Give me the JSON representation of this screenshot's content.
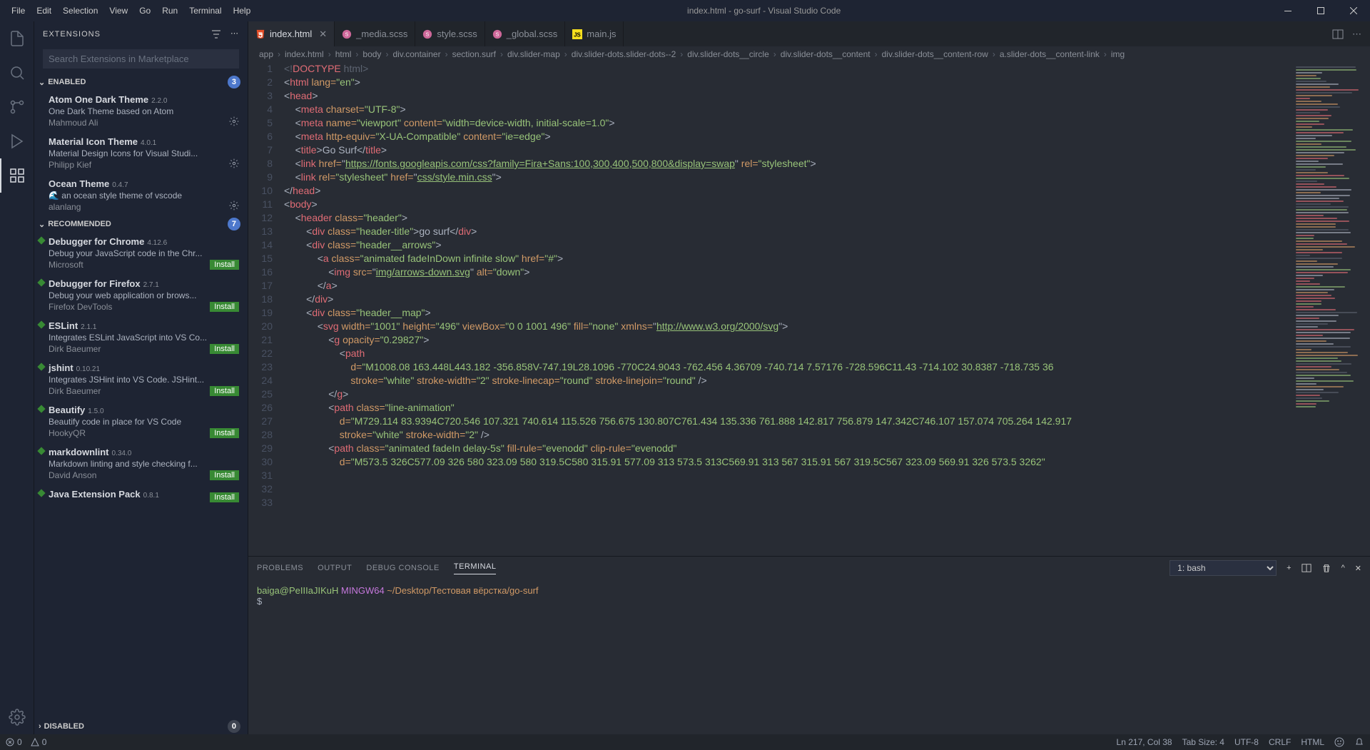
{
  "title": "index.html - go-surf - Visual Studio Code",
  "menu": [
    "File",
    "Edit",
    "Selection",
    "View",
    "Go",
    "Run",
    "Terminal",
    "Help"
  ],
  "sidebar": {
    "title": "EXTENSIONS",
    "search_placeholder": "Search Extensions in Marketplace",
    "enabled_label": "ENABLED",
    "enabled_count": "3",
    "recommended_label": "RECOMMENDED",
    "recommended_count": "7",
    "disabled_label": "DISABLED",
    "disabled_count": "0",
    "install_label": "Install"
  },
  "enabled_exts": [
    {
      "name": "Atom One Dark Theme",
      "ver": "2.2.0",
      "desc": "One Dark Theme based on Atom",
      "pub": "Mahmoud Ali"
    },
    {
      "name": "Material Icon Theme",
      "ver": "4.0.1",
      "desc": "Material Design Icons for Visual Studi...",
      "pub": "Philipp Kief"
    },
    {
      "name": "Ocean Theme",
      "ver": "0.4.7",
      "desc": "🌊 an ocean style theme of vscode",
      "pub": "alanlang"
    }
  ],
  "rec_exts": [
    {
      "name": "Debugger for Chrome",
      "ver": "4.12.6",
      "desc": "Debug your JavaScript code in the Chr...",
      "pub": "Microsoft"
    },
    {
      "name": "Debugger for Firefox",
      "ver": "2.7.1",
      "desc": "Debug your web application or brows...",
      "pub": "Firefox DevTools"
    },
    {
      "name": "ESLint",
      "ver": "2.1.1",
      "desc": "Integrates ESLint JavaScript into VS Co...",
      "pub": "Dirk Baeumer"
    },
    {
      "name": "jshint",
      "ver": "0.10.21",
      "desc": "Integrates JSHint into VS Code. JSHint...",
      "pub": "Dirk Baeumer"
    },
    {
      "name": "Beautify",
      "ver": "1.5.0",
      "desc": "Beautify code in place for VS Code",
      "pub": "HookyQR"
    },
    {
      "name": "markdownlint",
      "ver": "0.34.0",
      "desc": "Markdown linting and style checking f...",
      "pub": "David Anson"
    },
    {
      "name": "Java Extension Pack",
      "ver": "0.8.1",
      "desc": "",
      "pub": ""
    }
  ],
  "tabs": [
    {
      "label": "index.html",
      "icon": "html",
      "active": true,
      "dirty": false
    },
    {
      "label": "_media.scss",
      "icon": "scss",
      "active": false
    },
    {
      "label": "style.scss",
      "icon": "scss",
      "active": false
    },
    {
      "label": "_global.scss",
      "icon": "scss",
      "active": false
    },
    {
      "label": "main.js",
      "icon": "js",
      "active": false
    }
  ],
  "breadcrumb": [
    "app",
    "index.html",
    "html",
    "body",
    "div.container",
    "section.surf",
    "div.slider-map",
    "div.slider-dots.slider-dots--2",
    "div.slider-dots__circle",
    "div.slider-dots__content",
    "div.slider-dots__content-row",
    "a.slider-dots__content-link",
    "img"
  ],
  "line_numbers": [
    "1",
    "2",
    "3",
    "4",
    "5",
    "6",
    "7",
    "8",
    "9",
    "10",
    "11",
    "12",
    "13",
    "14",
    "15",
    "16",
    "17",
    "18",
    "19",
    "20",
    "21",
    "22",
    "23",
    "24",
    "25",
    "26",
    "27",
    "28",
    "29",
    "30",
    "31",
    "32",
    "33"
  ],
  "panel": {
    "tabs": [
      "PROBLEMS",
      "OUTPUT",
      "DEBUG CONSOLE",
      "TERMINAL"
    ],
    "active": "TERMINAL",
    "term_select": "1: bash",
    "term_user": "baiga@PeIIIaJIKuH",
    "term_host": "MINGW64",
    "term_path": "~/Desktop/Тестовая вёрстка/go-surf",
    "prompt": "$"
  },
  "status": {
    "errors": "0",
    "warnings": "0",
    "cursor": "Ln 217, Col 38",
    "tab_size": "Tab Size: 4",
    "encoding": "UTF-8",
    "eol": "CRLF",
    "lang": "HTML",
    "feedback": "😊"
  },
  "code": {
    "l1": "<!DOCTYPE html>",
    "l2a": "<html",
    "l2b": " lang=",
    "l2c": "\"en\"",
    "l2d": ">",
    "l4": "<head>",
    "l5a": "<meta",
    "l5b": " charset=",
    "l5c": "\"UTF-8\"",
    "l5d": ">",
    "l6a": "<meta",
    "l6b": " name=",
    "l6c": "\"viewport\"",
    "l6d": " content=",
    "l6e": "\"width=device-width, initial-scale=1.0\"",
    "l6f": ">",
    "l7a": "<meta",
    "l7b": " http-equiv=",
    "l7c": "\"X-UA-Compatible\"",
    "l7d": " content=",
    "l7e": "\"ie=edge\"",
    "l7f": ">",
    "l8a": "<title>",
    "l8b": "Go Surf",
    "l8c": "</title>",
    "l9a": "<link",
    "l9b": " href=",
    "l9c": "\"https://fonts.googleapis.com/css?family=Fira+Sans:100,300,400,500,800&display=swap\"",
    "l9d": " rel=",
    "l9e": "\"stylesheet\"",
    "l9f": ">",
    "l10a": "<link",
    "l10b": " rel=",
    "l10c": "\"stylesheet\"",
    "l10d": " href=",
    "l10e": "\"css/style.min.css\"",
    "l10f": ">",
    "l11": "</head>",
    "l13": "<body>",
    "l15a": "<header",
    "l15b": " class=",
    "l15c": "\"header\"",
    "l15d": ">",
    "l16a": "<div",
    "l16b": " class=",
    "l16c": "\"header-title\"",
    "l16d": ">",
    "l16e": "go surf",
    "l16f": "</div>",
    "l17a": "<div",
    "l17b": " class=",
    "l17c": "\"header__arrows\"",
    "l17d": ">",
    "l18a": "<a",
    "l18b": " class=",
    "l18c": "\"animated fadeInDown infinite slow\"",
    "l18d": " href=",
    "l18e": "\"#\"",
    "l18f": ">",
    "l19a": "<img",
    "l19b": " src=",
    "l19c": "\"img/arrows-down.svg\"",
    "l19d": " alt=",
    "l19e": "\"down\"",
    "l19f": ">",
    "l20": "</a>",
    "l21": "</div>",
    "l22a": "<div",
    "l22b": " class=",
    "l22c": "\"header__map\"",
    "l22d": ">",
    "l23a": "<svg",
    "l23b": " width=",
    "l23c": "\"1001\"",
    "l23d": " height=",
    "l23e": "\"496\"",
    "l23f": " viewBox=",
    "l23g": "\"0 0 1001 496\"",
    "l23h": " fill=",
    "l23i": "\"none\"",
    "l23j": " xmlns=",
    "l23k": "\"http://www.w3.org/2000/svg\"",
    "l23l": ">",
    "l24a": "<g",
    "l24b": " opacity=",
    "l24c": "\"0.29827\"",
    "l24d": ">",
    "l25": "<path",
    "l26a": "d=",
    "l26b": "\"M1008.08 163.448L443.182 -356.858V-747.19L28.1096 -770C24.9043 -762.456 4.36709 -740.714 7.57176 -728.596C11.43 -714.102 30.8387 -718.735 36",
    "l27a": "stroke=",
    "l27b": "\"white\"",
    "l27c": " stroke-width=",
    "l27d": "\"2\"",
    "l27e": " stroke-linecap=",
    "l27f": "\"round\"",
    "l27g": " stroke-linejoin=",
    "l27h": "\"round\"",
    "l27i": " />",
    "l28": "</g>",
    "l29a": "<path",
    "l29b": " class=",
    "l29c": "\"line-animation\"",
    "l30a": "d=",
    "l30b": "\"M729.114 83.9394C720.546 107.321 740.614 115.526 756.675 130.807C761.434 135.336 761.888 142.817 756.879 147.342C746.107 157.074 705.264 142.917",
    "l31a": "stroke=",
    "l31b": "\"white\"",
    "l31c": " stroke-width=",
    "l31d": "\"2\"",
    "l31e": " />",
    "l32a": "<path",
    "l32b": " class=",
    "l32c": "\"animated fadeIn delay-5s\"",
    "l32d": " fill-rule=",
    "l32e": "\"evenodd\"",
    "l32f": " clip-rule=",
    "l32g": "\"evenodd\"",
    "l33a": "d=",
    "l33b": "\"M573.5 326C577.09 326 580 323.09 580 319.5C580 315.91 577.09 313 573.5 313C569.91 313 567 315.91 567 319.5C567 323.09 569.91 326 573.5 3262\""
  }
}
